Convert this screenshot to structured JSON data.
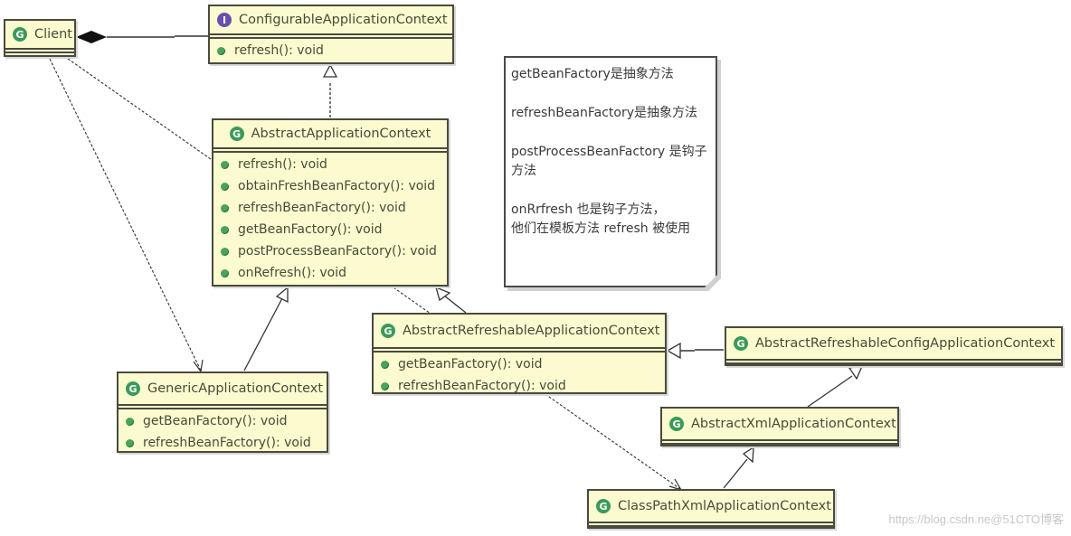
{
  "diagram": {
    "type": "UML class diagram",
    "classes": {
      "client": {
        "name": "Client",
        "kind": "class",
        "kind_icon": "G",
        "methods": []
      },
      "configurable": {
        "name": "ConfigurableApplicationContext",
        "kind": "interface",
        "kind_icon": "I",
        "methods": [
          "refresh(): void"
        ]
      },
      "abstract_app": {
        "name": "AbstractApplicationContext",
        "kind": "class",
        "kind_icon": "G",
        "methods": [
          "refresh(): void",
          "obtainFreshBeanFactory(): void",
          "refreshBeanFactory(): void",
          "getBeanFactory(): void",
          "postProcessBeanFactory(): void",
          "onRefresh(): void"
        ]
      },
      "generic": {
        "name": "GenericApplicationContext",
        "kind": "class",
        "kind_icon": "G",
        "methods": [
          "getBeanFactory(): void",
          "refreshBeanFactory(): void"
        ]
      },
      "abstract_refreshable": {
        "name": "AbstractRefreshableApplicationContext",
        "kind": "class",
        "kind_icon": "G",
        "methods": [
          "getBeanFactory(): void",
          "refreshBeanFactory(): void"
        ]
      },
      "abstract_refreshable_config": {
        "name": "AbstractRefreshableConfigApplicationContext",
        "kind": "class",
        "kind_icon": "G",
        "methods": []
      },
      "abstract_xml": {
        "name": "AbstractXmlApplicationContext",
        "kind": "class",
        "kind_icon": "G",
        "methods": []
      },
      "classpath_xml": {
        "name": "ClassPathXmlApplicationContext",
        "kind": "class",
        "kind_icon": "G",
        "methods": []
      }
    },
    "relations": [
      {
        "from": "Client",
        "to": "ConfigurableApplicationContext",
        "type": "composition"
      },
      {
        "from": "AbstractApplicationContext",
        "to": "ConfigurableApplicationContext",
        "type": "realization"
      },
      {
        "from": "GenericApplicationContext",
        "to": "AbstractApplicationContext",
        "type": "generalization"
      },
      {
        "from": "AbstractRefreshableApplicationContext",
        "to": "AbstractApplicationContext",
        "type": "generalization"
      },
      {
        "from": "AbstractRefreshableConfigApplicationContext",
        "to": "AbstractRefreshableApplicationContext",
        "type": "generalization"
      },
      {
        "from": "AbstractXmlApplicationContext",
        "to": "AbstractRefreshableConfigApplicationContext",
        "type": "generalization"
      },
      {
        "from": "ClassPathXmlApplicationContext",
        "to": "AbstractXmlApplicationContext",
        "type": "generalization"
      },
      {
        "from": "Client",
        "to": "GenericApplicationContext",
        "type": "dependency"
      },
      {
        "from": "Client",
        "to": "ClassPathXmlApplicationContext",
        "type": "dependency"
      }
    ],
    "note": {
      "lines": [
        "getBeanFactory是抽象方法",
        "refreshBeanFactory是抽象方法",
        "postProcessBeanFactory 是钩子方法",
        "onRrfresh 也是钩子方法，\n他们在模板方法 refresh 被使用"
      ]
    },
    "watermark": "https://blog.csdn.ne@51CTO博客"
  }
}
